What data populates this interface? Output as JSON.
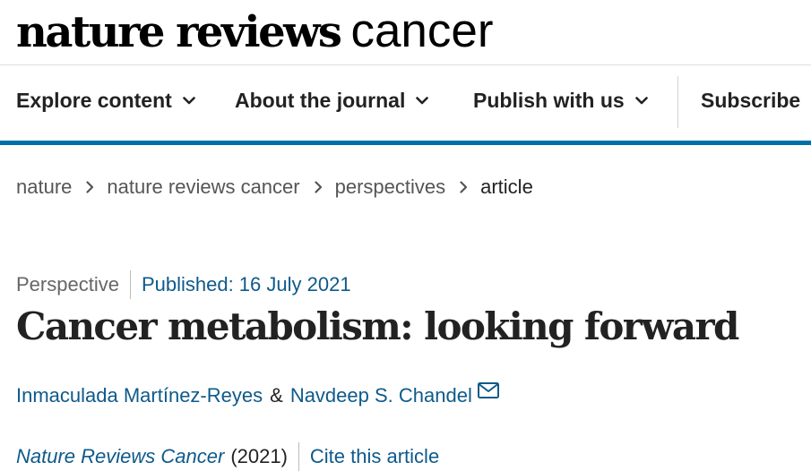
{
  "header": {
    "logo_primary": "nature reviews",
    "logo_secondary": "cancer"
  },
  "nav": {
    "items": [
      {
        "label": "Explore content",
        "icon": "chevron-down-icon"
      },
      {
        "label": "About the journal",
        "icon": "chevron-down-icon"
      },
      {
        "label": "Publish with us",
        "icon": "chevron-down-icon"
      }
    ],
    "subscribe_label": "Subscribe",
    "accent_color": "#0070a8"
  },
  "breadcrumb": {
    "items": [
      "nature",
      "nature reviews cancer",
      "perspectives"
    ],
    "current": "article"
  },
  "article": {
    "type": "Perspective",
    "published": "Published: 16 July 2021",
    "title": "Cancer metabolism: looking forward",
    "authors": [
      "Inmaculada Martínez-Reyes",
      "Navdeep S. Chandel"
    ],
    "author_separator": "&",
    "journal": "Nature Reviews Cancer",
    "year": "(2021)",
    "cite_label": "Cite this article",
    "link_color": "#0e5a8a"
  }
}
